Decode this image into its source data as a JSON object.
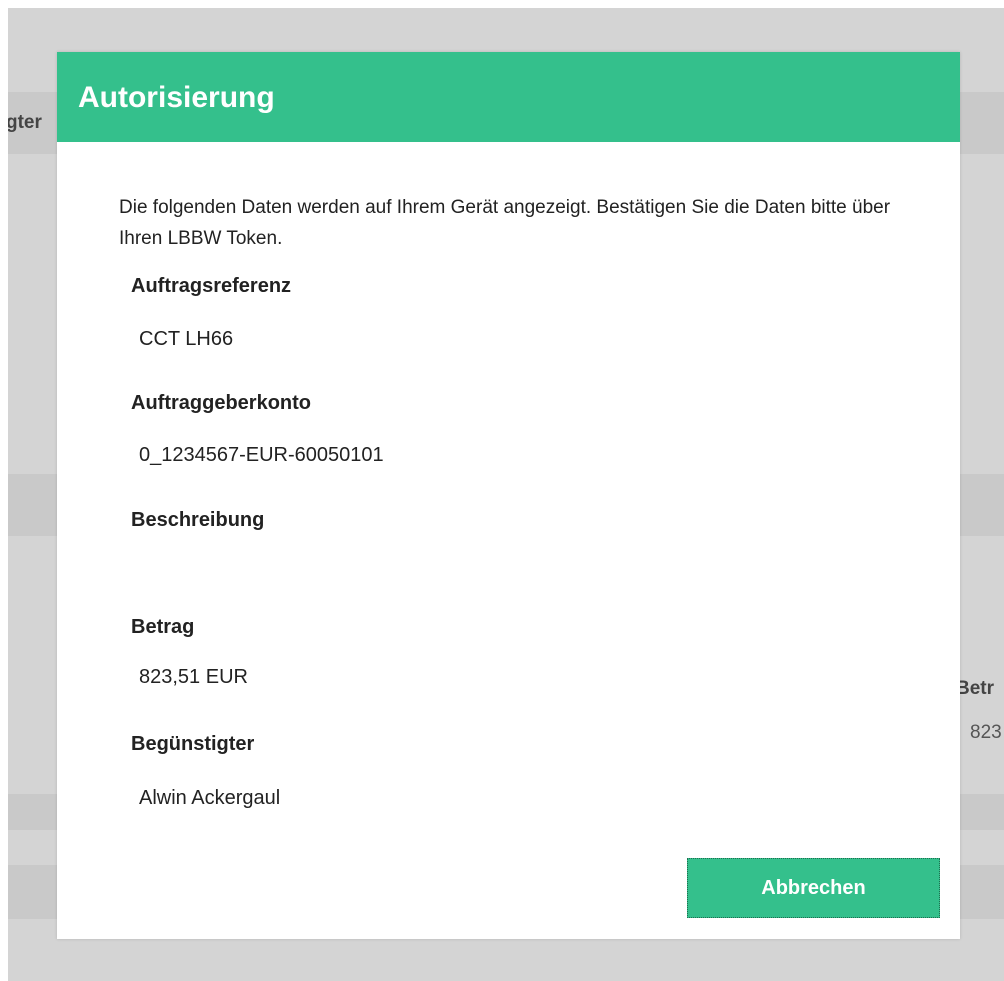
{
  "background": {
    "left_partial_text": "gter",
    "right_partial_label": "Betr",
    "right_partial_value": "823"
  },
  "dialog": {
    "title": "Autorisierung",
    "intro": "Die folgenden Daten werden auf Ihrem Gerät angezeigt. Bestätigen Sie die Daten bitte über Ihren LBBW Token.",
    "fields": [
      {
        "label": "Auftragsreferenz",
        "value": "CCT LH66"
      },
      {
        "label": "Auftraggeberkonto",
        "value": "0_1234567-EUR-60050101"
      },
      {
        "label": "Beschreibung",
        "value": ""
      },
      {
        "label": "Betrag",
        "value": "823,51 EUR"
      },
      {
        "label": "Begünstigter",
        "value": "Alwin Ackergaul"
      }
    ],
    "cancel_label": "Abbrechen"
  },
  "colors": {
    "accent": "#34c08c",
    "backdrop": "#d4d4d4"
  }
}
